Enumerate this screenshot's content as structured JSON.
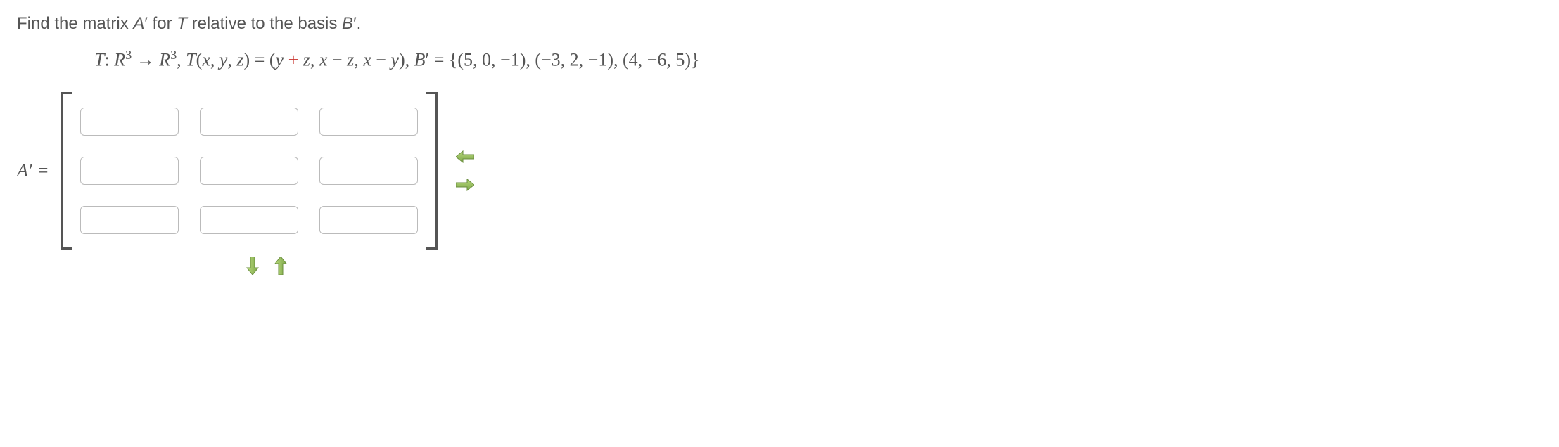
{
  "prompt": {
    "pre": "Find the matrix ",
    "A": "A",
    "prime1": "′",
    "mid1": " for ",
    "T": "T",
    "mid2": " relative to the basis ",
    "B": "B",
    "prime2": "′",
    "post": "."
  },
  "math": {
    "T": "T",
    "colon": ": ",
    "R1": "R",
    "sup1": "3",
    "arrow": " → ",
    "R2": "R",
    "sup2": "3",
    "comma1": ", ",
    "Tx": "T",
    "open": "(",
    "x1": "x",
    "c1": ", ",
    "y1": "y",
    "c2": ", ",
    "z1": "z",
    "close": ")",
    "eq": " = (",
    "y2": "y",
    "plus": " + ",
    "z2": "z",
    "c3": ", ",
    "x2": "x",
    "minus1": " − ",
    "z3": "z",
    "c4": ", ",
    "x3": "x",
    "minus2": " − ",
    "y3": "y",
    "close2": "), ",
    "B": "B",
    "prime": "′",
    "eq2": " = {(5, 0, −1), (−3, 2, −1), (4, −6, 5)}"
  },
  "lhs": {
    "A": "A",
    "prime": "′",
    "eq": " ="
  },
  "matrix": {
    "rows": 3,
    "cols": 3,
    "values": [
      [
        "",
        "",
        ""
      ],
      [
        "",
        "",
        ""
      ],
      [
        "",
        "",
        ""
      ]
    ]
  },
  "icons": {
    "left": "arrow-left-icon",
    "right": "arrow-right-icon",
    "down": "arrow-down-icon",
    "up": "arrow-up-icon"
  }
}
